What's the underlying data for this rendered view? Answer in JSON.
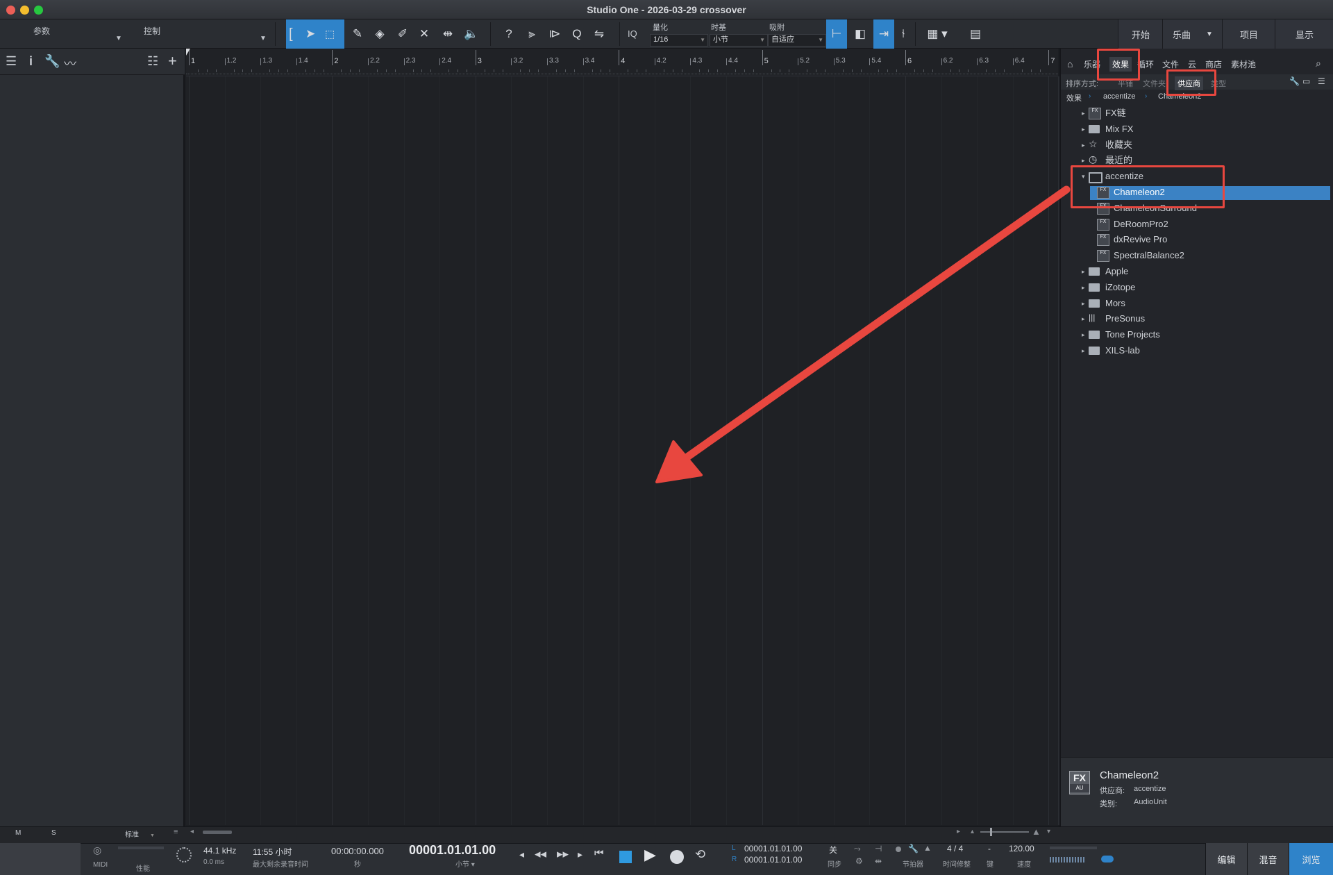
{
  "window": {
    "title": "Studio One - 2026-03-29 crossover"
  },
  "toolbar": {
    "params_label": "参数",
    "controls_label": "控制",
    "iq_label": "IQ",
    "quantize": {
      "label": "量化",
      "value": "1/16"
    },
    "timebase": {
      "label": "时基",
      "value": "小节"
    },
    "snap": {
      "label": "吸附",
      "value": "自适应"
    },
    "right_buttons": [
      "开始",
      "乐曲",
      "项目",
      "显示"
    ]
  },
  "ruler": {
    "labels": [
      "1",
      "1.2",
      "1.3",
      "1.4",
      "2",
      "2.2",
      "2.3",
      "2.4",
      "3",
      "3.2",
      "3.3",
      "3.4",
      "4",
      "4.2",
      "4.3",
      "4.4",
      "5",
      "5.2",
      "5.3",
      "5.4",
      "6",
      "6.2",
      "6.3",
      "6.4",
      "7"
    ]
  },
  "browser": {
    "tabs": [
      "乐器",
      "效果",
      "循环",
      "文件",
      "云",
      "商店",
      "素材池"
    ],
    "sort_label": "排序方式:",
    "sort_options": [
      "平铺",
      "文件夹",
      "供应商",
      "类型"
    ],
    "breadcrumb": [
      "效果",
      "accentize",
      "Chameleon2"
    ],
    "tree": [
      {
        "label": "FX链",
        "kind": "fxchain",
        "expanded": false
      },
      {
        "label": "Mix FX",
        "kind": "folder",
        "expanded": false
      },
      {
        "label": "收藏夹",
        "kind": "star",
        "expanded": false
      },
      {
        "label": "最近的",
        "kind": "clock",
        "expanded": false
      },
      {
        "label": "accentize",
        "kind": "folder-open",
        "expanded": true
      },
      {
        "label": "Chameleon2",
        "kind": "fx",
        "selected": true
      },
      {
        "label": "ChameleonSurround",
        "kind": "fx"
      },
      {
        "label": "DeRoomPro2",
        "kind": "fx"
      },
      {
        "label": "dxRevive Pro",
        "kind": "fx"
      },
      {
        "label": "SpectralBalance2",
        "kind": "fx"
      },
      {
        "label": "Apple",
        "kind": "folder",
        "expanded": false
      },
      {
        "label": "iZotope",
        "kind": "folder",
        "expanded": false
      },
      {
        "label": "Mors",
        "kind": "folder",
        "expanded": false
      },
      {
        "label": "PreSonus",
        "kind": "presonus",
        "expanded": false
      },
      {
        "label": "Tone Projects",
        "kind": "folder",
        "expanded": false
      },
      {
        "label": "XILS-lab",
        "kind": "folder",
        "expanded": false
      }
    ],
    "info": {
      "icon_top": "FX",
      "icon_bottom": "AU",
      "name": "Chameleon2",
      "vendor_label": "供应商:",
      "vendor": "accentize",
      "category_label": "类别:",
      "category": "AudioUnit"
    }
  },
  "bottom": {
    "m_label": "M",
    "s_label": "S",
    "view_mode": "标准"
  },
  "transport": {
    "midi_label": "MIDI",
    "perf_label": "性能",
    "sample_rate": "44.1 kHz",
    "latency": "0.0 ms",
    "record_time": "11:55 小时",
    "record_time_label": "最大剩余录音时间",
    "time_seconds": "00:00:00.000",
    "time_seconds_label": "秒",
    "time_bars": "00001.01.01.00",
    "time_bars_label": "小节",
    "loop_l_label": "L",
    "loop_l": "00001.01.01.00",
    "loop_r_label": "R",
    "loop_r": "00001.01.01.00",
    "sync_value": "关",
    "sync_label": "同步",
    "metronome_label": "节拍器",
    "signature": "4 / 4",
    "signature_label": "时间修整",
    "key": "-",
    "key_label": "键",
    "tempo": "120.00",
    "tempo_label": "速度",
    "nav_buttons": [
      "编辑",
      "混音",
      "浏览"
    ]
  },
  "colors": {
    "accent": "#2f83c9",
    "annotation": "#e8473f",
    "selection": "#3b82c4"
  }
}
